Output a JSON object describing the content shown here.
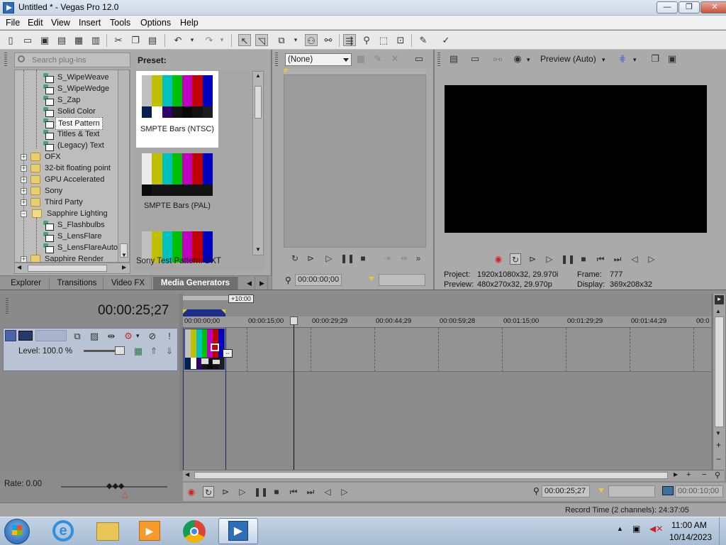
{
  "window": {
    "title": "Untitled * - Vegas Pro 12.0",
    "controls": {
      "minimize": "—",
      "maximize": "❐",
      "close": "✕"
    }
  },
  "menu": [
    "File",
    "Edit",
    "View",
    "Insert",
    "Tools",
    "Options",
    "Help"
  ],
  "explorer": {
    "search_placeholder": "Search plug-ins",
    "tree": [
      {
        "label": "S_WipeWeave",
        "kind": "fx"
      },
      {
        "label": "S_WipeWedge",
        "kind": "fx"
      },
      {
        "label": "S_Zap",
        "kind": "fx"
      },
      {
        "label": "Solid Color",
        "kind": "fx"
      },
      {
        "label": "Test Pattern",
        "kind": "fx",
        "selected": true
      },
      {
        "label": "Titles & Text",
        "kind": "fx"
      },
      {
        "label": "(Legacy) Text",
        "kind": "fx"
      },
      {
        "label": "OFX",
        "kind": "folder",
        "expander": "+"
      },
      {
        "label": "32-bit floating point",
        "kind": "folder",
        "expander": "+"
      },
      {
        "label": "GPU Accelerated",
        "kind": "folder",
        "expander": "+"
      },
      {
        "label": "Sony",
        "kind": "folder",
        "expander": "+"
      },
      {
        "label": "Third Party",
        "kind": "folder",
        "expander": "+"
      },
      {
        "label": "Sapphire Lighting",
        "kind": "folder",
        "expander": "−"
      },
      {
        "label": "S_Flashbulbs",
        "kind": "fx"
      },
      {
        "label": "S_LensFlare",
        "kind": "fx"
      },
      {
        "label": "S_LensFlareAutoT",
        "kind": "fx"
      },
      {
        "label": "Sapphire Render",
        "kind": "folder",
        "expander": "+"
      }
    ],
    "preset_label": "Preset:",
    "presets": [
      {
        "name": "SMPTE Bars (NTSC)",
        "selected": true
      },
      {
        "name": "SMPTE Bars (PAL)",
        "selected": false
      },
      {
        "name": "Sony Test Pattern: DXT",
        "selected": false
      }
    ],
    "tabs": [
      "Explorer",
      "Transitions",
      "Video FX",
      "Media Generators"
    ],
    "active_tab": "Media Generators"
  },
  "trimmer": {
    "select_value": "(None)",
    "time": "00:00:00;00"
  },
  "preview": {
    "mode": "Preview (Auto)",
    "project_label": "Project:",
    "project_value": "1920x1080x32, 29.970i",
    "preview_label": "Preview:",
    "preview_value": "480x270x32, 29.970p",
    "frame_label": "Frame:",
    "frame_value": "777",
    "display_label": "Display:",
    "display_value": "369x208x32"
  },
  "timeline": {
    "timecode": "00:00:25;27",
    "loop_label": "+10:00",
    "track_level": "Level: 100.0 %",
    "ruler": [
      "00:00:00;00",
      "00:00:15;00",
      "00:00:29;29",
      "00:00:44;29",
      "00:00:59;28",
      "00:01:15;00",
      "00:01:29;29",
      "00:01:44;29",
      "00:0"
    ],
    "rate": "Rate: 0.00",
    "cursor_time": "00:00:25;27",
    "end_time": "00:00:10;00",
    "record_time": "Record Time (2 channels): 24:37:05"
  },
  "taskbar": {
    "clock_time": "11:00 AM",
    "clock_date": "10/14/2023"
  },
  "colors": {
    "smpte_top": [
      "#c0c0c0",
      "#c0c000",
      "#00c0c0",
      "#00c000",
      "#c000c0",
      "#c00000",
      "#0000c0"
    ],
    "smpte_mid": [
      "#0000c0",
      "#131313",
      "#c000c0",
      "#131313",
      "#00c0c0",
      "#131313",
      "#c0c0c0"
    ],
    "smpte_bottom": [
      "#00214c",
      "#ffffff",
      "#32006a",
      "#131313",
      "#090909",
      "#131313",
      "#1d1d1d"
    ],
    "pal_top": [
      "#ebebeb",
      "#bfbf00",
      "#00bfbf",
      "#00bf00",
      "#bf00bf",
      "#bf0000",
      "#0000bf"
    ]
  }
}
